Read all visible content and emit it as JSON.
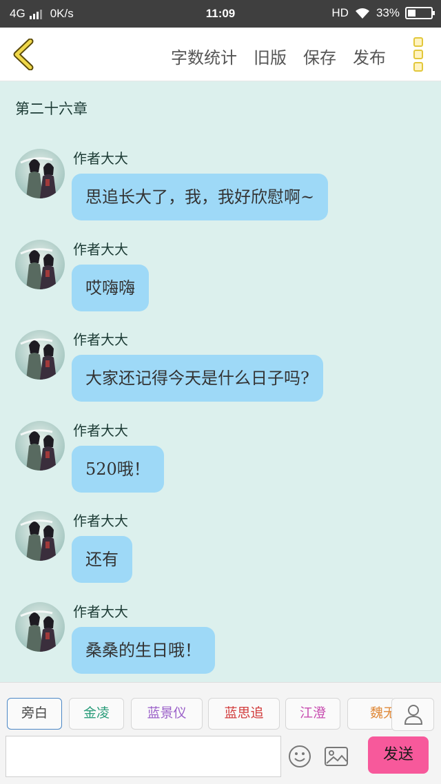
{
  "status_bar": {
    "network": "4G",
    "speed": "0K/s",
    "time": "11:09",
    "hd": "HD",
    "battery": "33%",
    "battery_level": 0.33
  },
  "header": {
    "back_icon": "chevron-left-icon",
    "actions": [
      "字数统计",
      "旧版",
      "保存",
      "发布"
    ],
    "more_icon": "more-vertical-icon"
  },
  "chapter_title": "第二十六章",
  "messages": [
    {
      "author": "作者大大",
      "text": "思追长大了，我，我好欣慰啊~"
    },
    {
      "author": "作者大大",
      "text": "哎嗨嗨"
    },
    {
      "author": "作者大大",
      "text": "大家还记得今天是什么日子吗?"
    },
    {
      "author": "作者大大",
      "text": "520哦！"
    },
    {
      "author": "作者大大",
      "text": "还有"
    },
    {
      "author": "作者大大",
      "text": "桑桑的生日哦！"
    }
  ],
  "roles": [
    {
      "label": "旁白",
      "color": "#444444"
    },
    {
      "label": "金凌",
      "color": "#2a9c7a"
    },
    {
      "label": "蓝景仪",
      "color": "#9a5fc8"
    },
    {
      "label": "蓝思追",
      "color": "#d23c3c"
    },
    {
      "label": "江澄",
      "color": "#c84db0"
    },
    {
      "label": "魏无",
      "color": "#e08a3a"
    }
  ],
  "input": {
    "value": "",
    "placeholder": ""
  },
  "send_label": "发送"
}
